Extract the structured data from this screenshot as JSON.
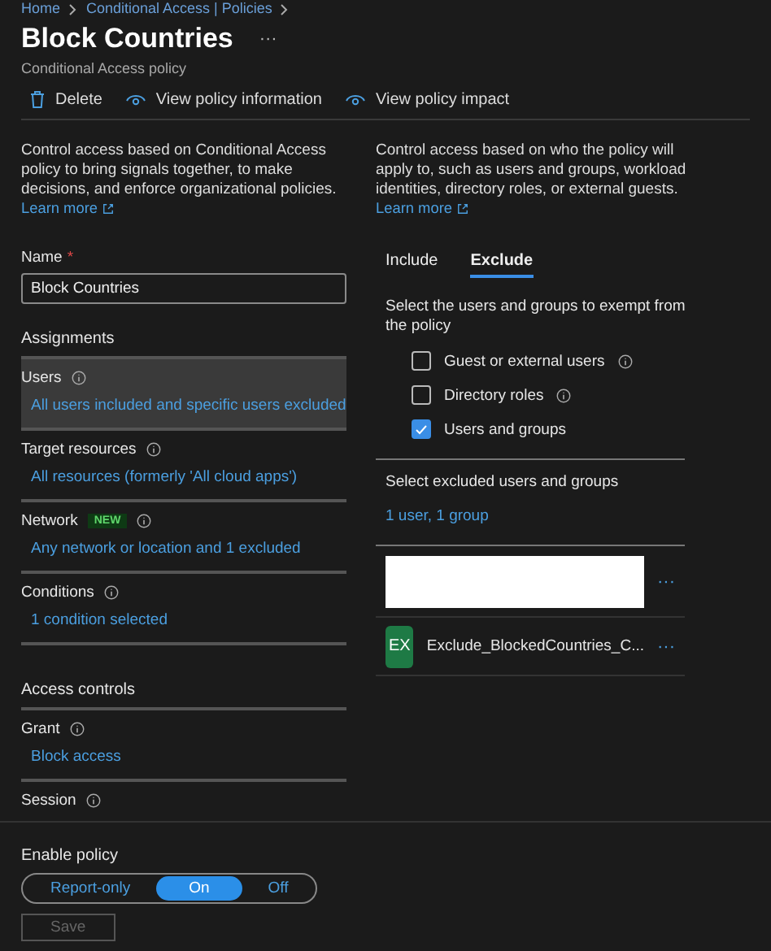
{
  "breadcrumb": [
    "Home",
    "Conditional Access | Policies"
  ],
  "title": "Block Countries",
  "more": "···",
  "subtitle": "Conditional Access policy",
  "toolbar": [
    {
      "kind": "delete",
      "label": "Delete"
    },
    {
      "kind": "view",
      "label": "View policy information"
    },
    {
      "kind": "view",
      "label": "View policy impact"
    }
  ],
  "left": {
    "description": "Control access based on Conditional Access policy to bring signals together, to make decisions, and enforce organizational policies.",
    "learn_more": "Learn more",
    "name_label": "Name",
    "name_required": "*",
    "name_value": "Block Countries",
    "sections": [
      {
        "heading": "Assignments",
        "items": [
          {
            "label": "Users",
            "info": true,
            "value": "All users included and specific users excluded",
            "selected": true
          },
          {
            "label": "Target resources",
            "info": true,
            "value": "All resources (formerly 'All cloud apps')",
            "selected": false
          },
          {
            "label": "Network",
            "badge": "NEW",
            "info": true,
            "value": "Any network or location and 1 excluded",
            "selected": false
          },
          {
            "label": "Conditions",
            "info": true,
            "value": "1 condition selected",
            "selected": false
          }
        ]
      },
      {
        "heading": "Access controls",
        "items": [
          {
            "label": "Grant",
            "info": true,
            "value": "Block access",
            "selected": false
          },
          {
            "label": "Session",
            "info": true,
            "selected": false
          }
        ]
      }
    ]
  },
  "right": {
    "description": "Control access based on who the policy will apply to, such as users and groups, workload identities, directory roles, or external guests.",
    "learn_more": "Learn more",
    "tabs": [
      {
        "label": "Include",
        "selected": false
      },
      {
        "label": "Exclude",
        "selected": true
      }
    ],
    "prompt": "Select the users and groups to exempt from the policy",
    "options": [
      {
        "label": "Guest or external users",
        "info": true,
        "checked": false
      },
      {
        "label": "Directory roles",
        "info": true,
        "checked": false
      },
      {
        "label": "Users and groups",
        "info": false,
        "checked": true
      }
    ],
    "selected_heading": "Select excluded users and groups",
    "selected_summary": "1 user, 1 group",
    "members": [
      {
        "kind": "redacted",
        "more": "···"
      },
      {
        "kind": "group",
        "initials": "EX",
        "name": "Exclude_BlockedCountries_C...",
        "more": "···"
      }
    ]
  },
  "footer": {
    "label": "Enable policy",
    "options": [
      {
        "label": "Report-only",
        "selected": false
      },
      {
        "label": "On",
        "selected": true
      },
      {
        "label": "Off",
        "selected": false
      }
    ],
    "save": {
      "label": "Save",
      "disabled": true
    }
  }
}
